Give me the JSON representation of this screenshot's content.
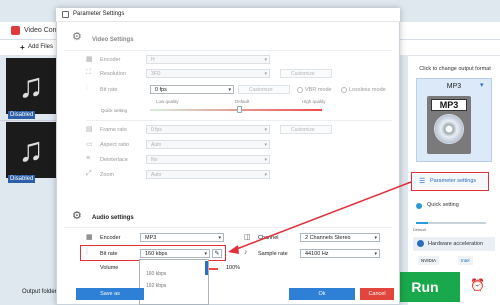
{
  "app": {
    "title": "Video Conve",
    "add_files": "Add Files",
    "items": [
      {
        "status": "Disabled"
      },
      {
        "status": "Disabled"
      }
    ],
    "output_folder_label": "Output folder:",
    "right_panel": {
      "caption": "Click to change output format",
      "format": "MP3",
      "format_badge": "MP3",
      "parameter_settings": "Parameter settings",
      "quick_setting": "Quick setting",
      "quick_default": "Default",
      "hardware_accel": "Hardware acceleration",
      "nvidia": "NVIDIA",
      "intel": "Intel",
      "run": "Run"
    }
  },
  "dialog": {
    "title": "Parameter Settings",
    "video": {
      "title": "Video Settings",
      "encoder_label": "Encoder",
      "encoder_value": "H",
      "resolution_label": "Resolution",
      "resolution_value": "3FD",
      "customize": "Customize",
      "bitrate_label": "Bit rate",
      "bitrate_value": "0 fps",
      "vbr_mode": "VBR mode",
      "lossless_mode": "Lossless mode",
      "low_quality": "Low quality",
      "default": "Default",
      "high_quality": "High quality",
      "quick_setting": "Quick setting",
      "frame_rate_label": "Frame rate",
      "frame_rate_value": "0 fps",
      "aspect_ratio_label": "Aspect ratio",
      "aspect_ratio_value": "Auto",
      "deinterlace_label": "Deinterlace",
      "deinterlace_value": "No",
      "zoom_label": "Zoom",
      "zoom_value": "Auto"
    },
    "audio": {
      "title": "Audio settings",
      "encoder_label": "Encoder",
      "encoder_value": "MP3",
      "channel_label": "Channel",
      "channel_value": "2 Channels Stereo",
      "bitrate_label": "Bit rate",
      "bitrate_value": "160 kbps",
      "sample_rate_label": "Sample rate",
      "sample_rate_value": "44100 Hz",
      "volume_label": "Volume",
      "volume_value": "100%",
      "dropdown_options": [
        "160 kbps",
        "192 kbps"
      ]
    },
    "save_as": "Save as",
    "ok": "Ok",
    "cancel": "Cancel"
  },
  "colors": {
    "accent": "#2e7fd6",
    "highlight": "#e0303a",
    "run": "#19a84b"
  }
}
